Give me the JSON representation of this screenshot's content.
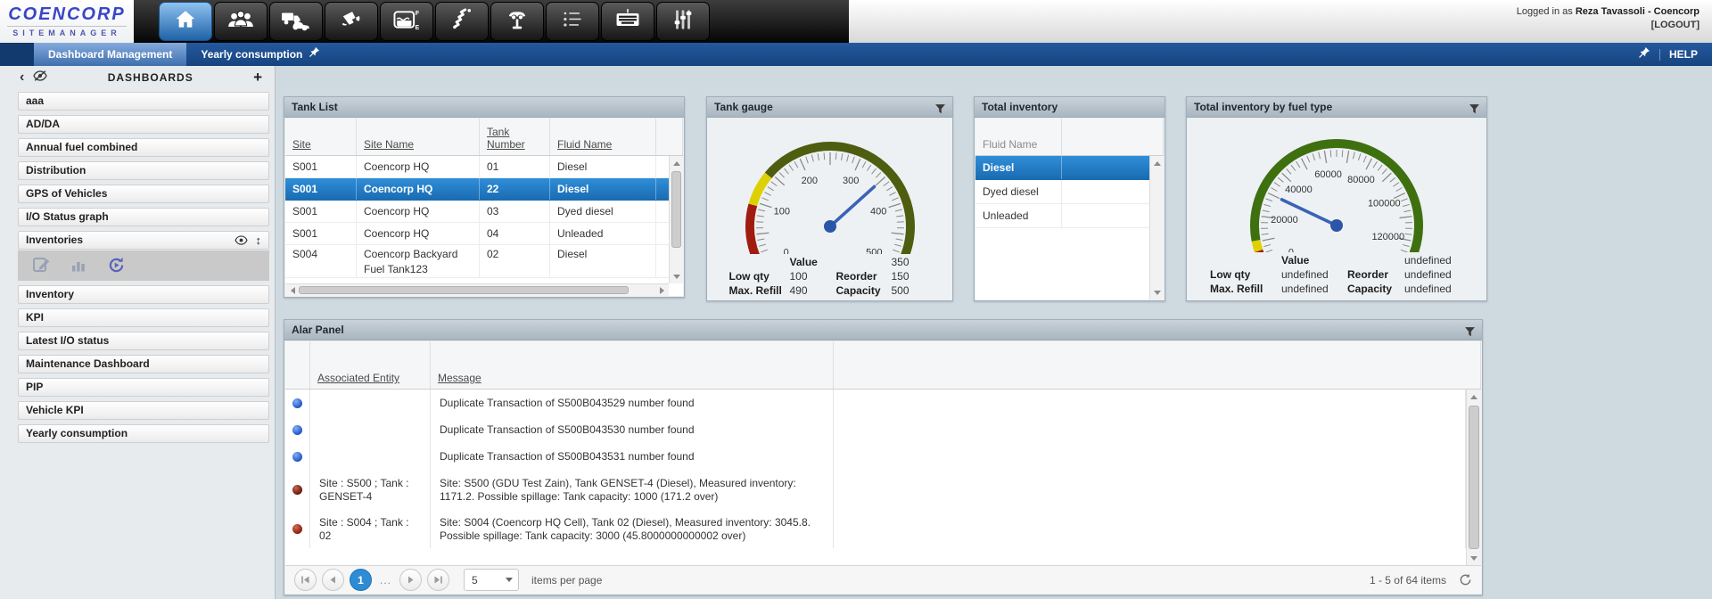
{
  "header": {
    "logo_line1": "COENCORP",
    "logo_line2": "SITEMANAGER",
    "logged_in_prefix": "Logged in as",
    "user": "Reza Tavassoli - Coencorp",
    "logout": "[LOGOUT]",
    "nav_icons": [
      {
        "name": "home",
        "active": true
      },
      {
        "name": "people"
      },
      {
        "name": "vehicles"
      },
      {
        "name": "fuel-nozzle"
      },
      {
        "name": "tank-level"
      },
      {
        "name": "coil-spring"
      },
      {
        "name": "vehicle-lift"
      },
      {
        "name": "list"
      },
      {
        "name": "keyboard"
      },
      {
        "name": "sliders"
      }
    ]
  },
  "tabbar": {
    "tabs": [
      {
        "label": "Dashboard Management",
        "active": true
      },
      {
        "label": "Yearly consumption",
        "pinned": true
      }
    ],
    "help": "HELP"
  },
  "sidebar": {
    "title": "DASHBOARDS",
    "items": [
      {
        "label": "aaa"
      },
      {
        "label": "AD/DA"
      },
      {
        "label": "Annual fuel combined"
      },
      {
        "label": "Distribution"
      },
      {
        "label": "GPS of Vehicles"
      },
      {
        "label": "I/O Status graph"
      },
      {
        "label": "Inventories",
        "active": true,
        "trailing_icons": [
          "eye",
          "move"
        ],
        "toolbar": [
          "edit",
          "chart",
          "refresh"
        ]
      },
      {
        "label": "Inventory"
      },
      {
        "label": "KPI"
      },
      {
        "label": "Latest I/O status"
      },
      {
        "label": "Maintenance Dashboard"
      },
      {
        "label": "PIP"
      },
      {
        "label": "Vehicle KPI"
      },
      {
        "label": "Yearly consumption"
      }
    ]
  },
  "tank_list": {
    "title": "Tank List",
    "columns": [
      "Site",
      "Site Name",
      "Tank Number",
      "Fluid Name"
    ],
    "rows": [
      [
        "S001",
        "Coencorp HQ",
        "01",
        "Diesel"
      ],
      [
        "S001",
        "Coencorp HQ",
        "22",
        "Diesel"
      ],
      [
        "S001",
        "Coencorp HQ",
        "03",
        "Dyed diesel"
      ],
      [
        "S001",
        "Coencorp HQ",
        "04",
        "Unleaded"
      ],
      [
        "S004",
        "Coencorp Backyard Fuel Tank123",
        "02",
        "Diesel"
      ]
    ],
    "selected_row": 1
  },
  "total_inventory": {
    "title": "Total inventory",
    "column": "Fluid Name",
    "rows": [
      "Diesel",
      "Dyed diesel",
      "Unleaded"
    ],
    "selected_row": 0
  },
  "alarm_panel": {
    "title": "Alar Panel",
    "columns": [
      "Associated Entity",
      "Message"
    ],
    "rows": [
      {
        "icon": "info",
        "entity": "",
        "message": "Duplicate Transaction of S500B043529 number found"
      },
      {
        "icon": "info",
        "entity": "",
        "message": "Duplicate Transaction of S500B043530 number found"
      },
      {
        "icon": "info",
        "entity": "",
        "message": "Duplicate Transaction of S500B043531 number found"
      },
      {
        "icon": "warn-dark",
        "entity": "Site : S500 ; Tank : GENSET-4",
        "message": "Site: S500 (GDU Test Zain), Tank GENSET-4 (Diesel), Measured inventory: 1171.2. Possible spillage: Tank capacity: 1000 (171.2 over)"
      },
      {
        "icon": "warn",
        "entity": "Site : S004 ; Tank : 02",
        "message": "Site: S004 (Coencorp HQ Cell), Tank 02 (Diesel), Measured inventory: 3045.8. Possible spillage: Tank capacity: 3000 (45.8000000000002 over)"
      }
    ]
  },
  "pager": {
    "page": "1",
    "more": "...",
    "page_size": "5",
    "items_per_page_label": "items per page",
    "range_label": "1 - 5 of 64 items"
  },
  "colors": {
    "accent_blue": "#2e8cd5",
    "selected_row_blue": "#1e74ba",
    "tabbar_blue": "#1b4f93",
    "gauge_green": "#4f5d10",
    "gauge_red": "#a01c10",
    "gauge_yellow": "#ddd104",
    "needle_blue": "#3a62b8"
  },
  "chart_data": [
    {
      "type": "gauge",
      "title": "Tank gauge",
      "min": 0,
      "max": 500,
      "value": 350,
      "major_tick": 50,
      "minor_tick": 10,
      "tick_labels": [
        0,
        100,
        200,
        300,
        400,
        500
      ],
      "ranges": [
        {
          "from": 0,
          "to": 18,
          "color": "#5e140b"
        },
        {
          "from": 18,
          "to": 95,
          "color": "#a01c10"
        },
        {
          "from": 95,
          "to": 145,
          "color": "#ddd104"
        },
        {
          "from": 145,
          "to": 488,
          "color": "#4f5d10"
        },
        {
          "from": 488,
          "to": 500,
          "color": "#becb08"
        }
      ],
      "stats_rows": [
        [
          {
            "t": ""
          },
          {
            "t": "Value",
            "b": true
          },
          {
            "t": ""
          },
          {
            "t": "350"
          }
        ],
        [
          {
            "t": "Low qty",
            "b": true
          },
          {
            "t": "100"
          },
          {
            "t": "Reorder",
            "b": true
          },
          {
            "t": "150"
          }
        ],
        [
          {
            "t": "Max. Refill",
            "b": true
          },
          {
            "t": "490"
          },
          {
            "t": "Capacity",
            "b": true
          },
          {
            "t": "500"
          }
        ]
      ]
    },
    {
      "type": "gauge",
      "title": "Total inventory by fuel type",
      "min": 0,
      "max": 130000,
      "value": 30000,
      "major_tick": 10000,
      "minor_tick": 2500,
      "tick_labels": [
        0,
        20000,
        40000,
        60000,
        80000,
        100000,
        120000
      ],
      "ranges": [
        {
          "from": 0,
          "to": 2000,
          "color": "#5e140b"
        },
        {
          "from": 2000,
          "to": 6500,
          "color": "#a01c10"
        },
        {
          "from": 6500,
          "to": 10500,
          "color": "#ddd104"
        },
        {
          "from": 10500,
          "to": 125000,
          "color": "#3f7010"
        },
        {
          "from": 125000,
          "to": 130000,
          "color": "#b9c908"
        }
      ],
      "stats_rows": [
        [
          {
            "t": ""
          },
          {
            "t": "Value",
            "b": true
          },
          {
            "t": ""
          },
          {
            "t": "undefined"
          }
        ],
        [
          {
            "t": "Low qty",
            "b": true
          },
          {
            "t": "undefined"
          },
          {
            "t": "Reorder",
            "b": true
          },
          {
            "t": "undefined"
          }
        ],
        [
          {
            "t": "Max. Refill",
            "b": true
          },
          {
            "t": "undefined"
          },
          {
            "t": "Capacity",
            "b": true
          },
          {
            "t": "undefined"
          }
        ]
      ]
    }
  ]
}
